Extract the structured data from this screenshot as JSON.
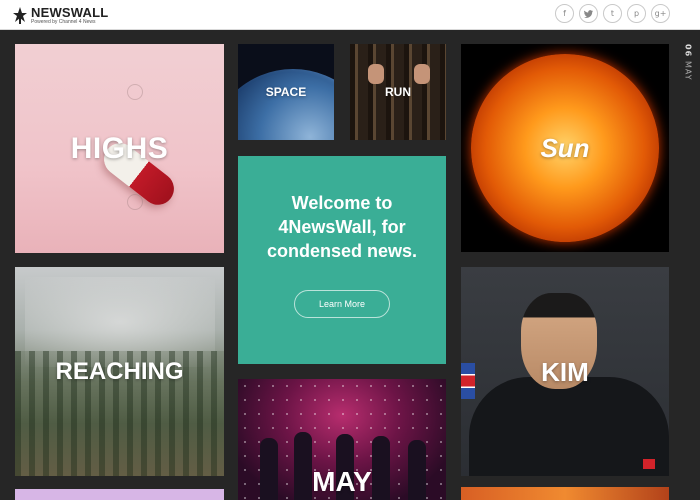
{
  "header": {
    "brand": "NEWSWALL",
    "brand_sub": "Powered by Channel 4 News",
    "social": [
      {
        "icon": "facebook-icon",
        "glyph": "f"
      },
      {
        "icon": "twitter-icon",
        "glyph": "🐦"
      },
      {
        "icon": "tumblr-icon",
        "glyph": "t"
      },
      {
        "icon": "pinterest-icon",
        "glyph": "p"
      },
      {
        "icon": "googleplus-icon",
        "glyph": "g+"
      }
    ]
  },
  "date": {
    "day": "06",
    "month": "MAY"
  },
  "tiles": {
    "highs": "HIGHS",
    "reaching": "REACHING",
    "space": "SPACE",
    "run": "RUN",
    "sun": "Sun",
    "kim": "KIM",
    "may": "MAY"
  },
  "welcome": {
    "text": "Welcome to 4NewsWall, for condensed news.",
    "button": "Learn More"
  },
  "colors": {
    "background": "#262626",
    "welcome_tile": "#3aae96",
    "header": "#ffffff"
  }
}
